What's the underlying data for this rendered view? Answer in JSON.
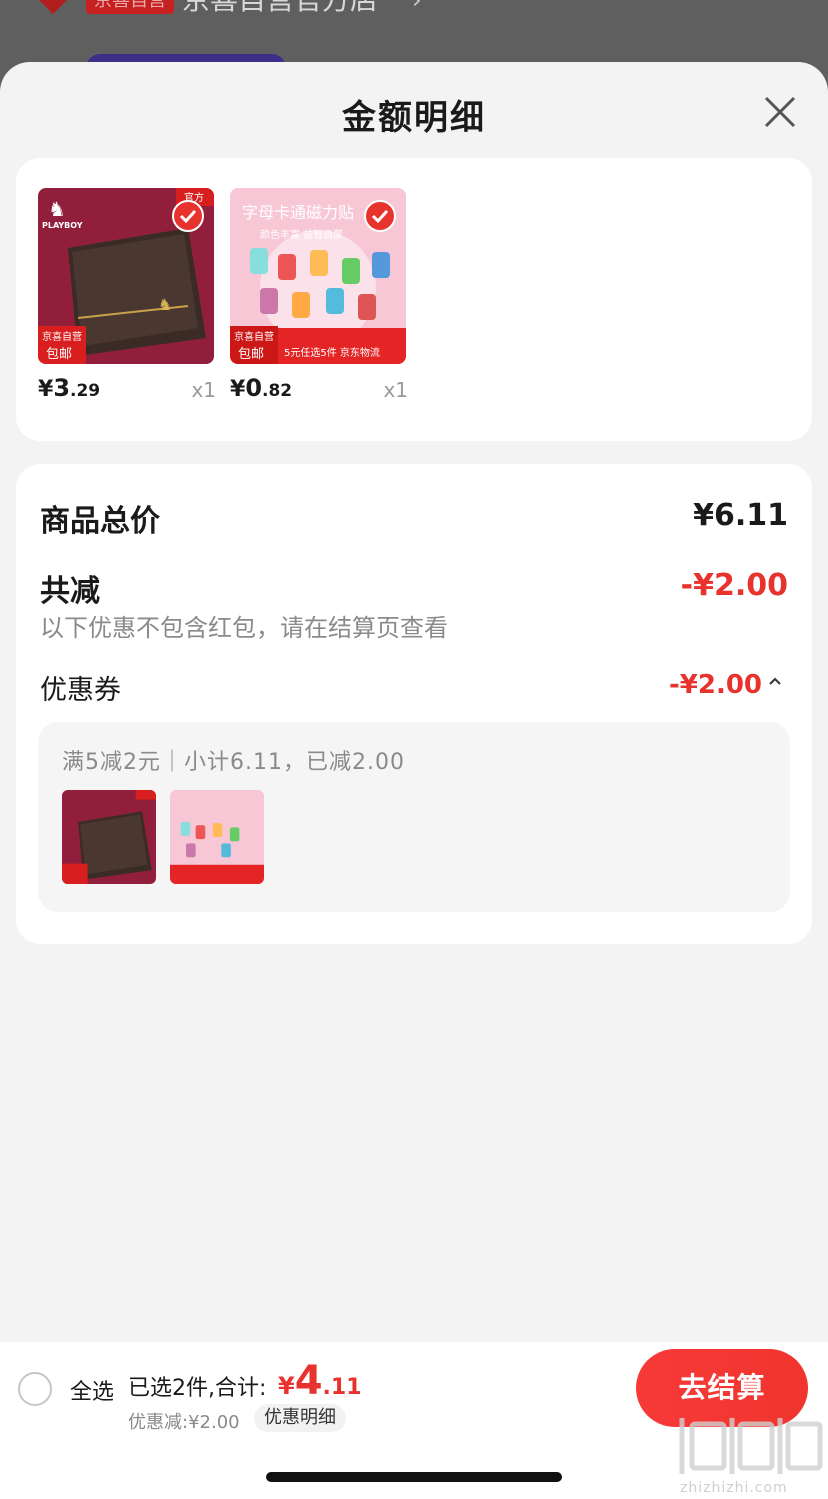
{
  "background": {
    "store_badge": "京喜自营",
    "store_name": "京喜自营官方店"
  },
  "sheet": {
    "title": "金额明细"
  },
  "products": [
    {
      "name": "wallet",
      "price_currency": "¥",
      "price_int": "3",
      "price_dec": ".29",
      "qty": "x1",
      "badge_line1": "京喜自营",
      "badge_line2": "包邮",
      "corner_tag": "官方",
      "brand": "PLAYBOY"
    },
    {
      "name": "magnet-toy",
      "price_currency": "¥",
      "price_int": "0",
      "price_dec": ".82",
      "qty": "x1",
      "badge_line1": "京喜自营",
      "badge_line2": "包邮",
      "banner": "字母卡通磁力贴",
      "sub_banner": "颜色丰富 益智启蒙",
      "promo_strip": "5元任选5件 京东物流"
    }
  ],
  "summary": {
    "total_label": "商品总价",
    "total_value": "¥6.11",
    "reduce_label": "共减",
    "reduce_value": "-¥2.00",
    "note": "以下优惠不包含红包，请在结算页查看",
    "coupon_label": "优惠券",
    "coupon_value": "-¥2.00",
    "coupon_detail": "满5减2元｜小计6.11，已减2.00"
  },
  "bottom_bar": {
    "select_all": "全选",
    "selected_text": "已选2件,合计:",
    "total_currency": "¥",
    "total_int": "4",
    "total_dec": ".11",
    "discount_text": "优惠减:¥2.00",
    "detail_button": "优惠明细",
    "checkout_button": "去结算"
  },
  "watermark": "zhizhizhi.com",
  "colors": {
    "accent": "#e8322e",
    "checkout": "#f73a38"
  }
}
